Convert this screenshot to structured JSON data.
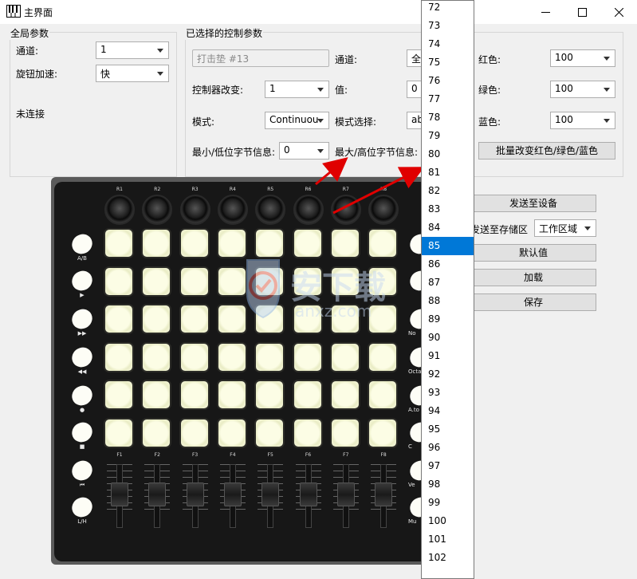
{
  "window": {
    "title": "主界面"
  },
  "global_params": {
    "title": "全局参数",
    "channel_label": "通道:",
    "channel_value": "1",
    "knob_accel_label": "旋钮加速:",
    "knob_accel_value": "快",
    "status": "未连接"
  },
  "selected_params": {
    "title": "已选择的控制参数",
    "pad_name": "打击垫 #13",
    "channel_label": "通道:",
    "channel_value": "全",
    "controller_label": "控制器改变:",
    "controller_value": "1",
    "value_label": "值:",
    "value_value": "0",
    "mode_label": "模式:",
    "mode_value": "Continuou",
    "mode_select_label": "模式选择:",
    "mode_select_value": "ab",
    "min_label": "最小/低位字节信息:",
    "min_value": "0",
    "max_label": "最大/高位字节信息:",
    "red_label": "红色:",
    "red_value": "100",
    "green_label": "绿色:",
    "green_value": "100",
    "blue_label": "蓝色:",
    "blue_value": "100",
    "batch_button": "批量改变红色/绿色/蓝色"
  },
  "actions": {
    "send_device": "发送至设备",
    "send_storage_label": "发送至存储区",
    "storage_value": "工作区域",
    "defaults": "默认值",
    "load": "加载",
    "save": "保存"
  },
  "dropdown": {
    "items": [
      "72",
      "73",
      "74",
      "75",
      "76",
      "77",
      "78",
      "79",
      "80",
      "81",
      "82",
      "83",
      "84",
      "85",
      "86",
      "87",
      "88",
      "89",
      "90",
      "91",
      "92",
      "93",
      "94",
      "95",
      "96",
      "97",
      "98",
      "99",
      "100",
      "101",
      "102"
    ],
    "selected": "85"
  },
  "device": {
    "knob_labels": [
      "R1",
      "R2",
      "R3",
      "R4",
      "R5",
      "R6",
      "R7",
      "R8"
    ],
    "fader_labels": [
      "F1",
      "F2",
      "F3",
      "F4",
      "F5",
      "F6",
      "F7",
      "F8"
    ],
    "left_button_labels": [
      "A/B",
      "▶",
      "▶▶",
      "◀◀",
      "●",
      "■",
      "⏮",
      "L/H"
    ],
    "right_button_labels": [
      "",
      "",
      "No",
      "Octa",
      "A.to",
      "C",
      "Ve",
      "Mu"
    ]
  },
  "watermark": {
    "text": "安下载",
    "subtext": "anxz.com"
  }
}
